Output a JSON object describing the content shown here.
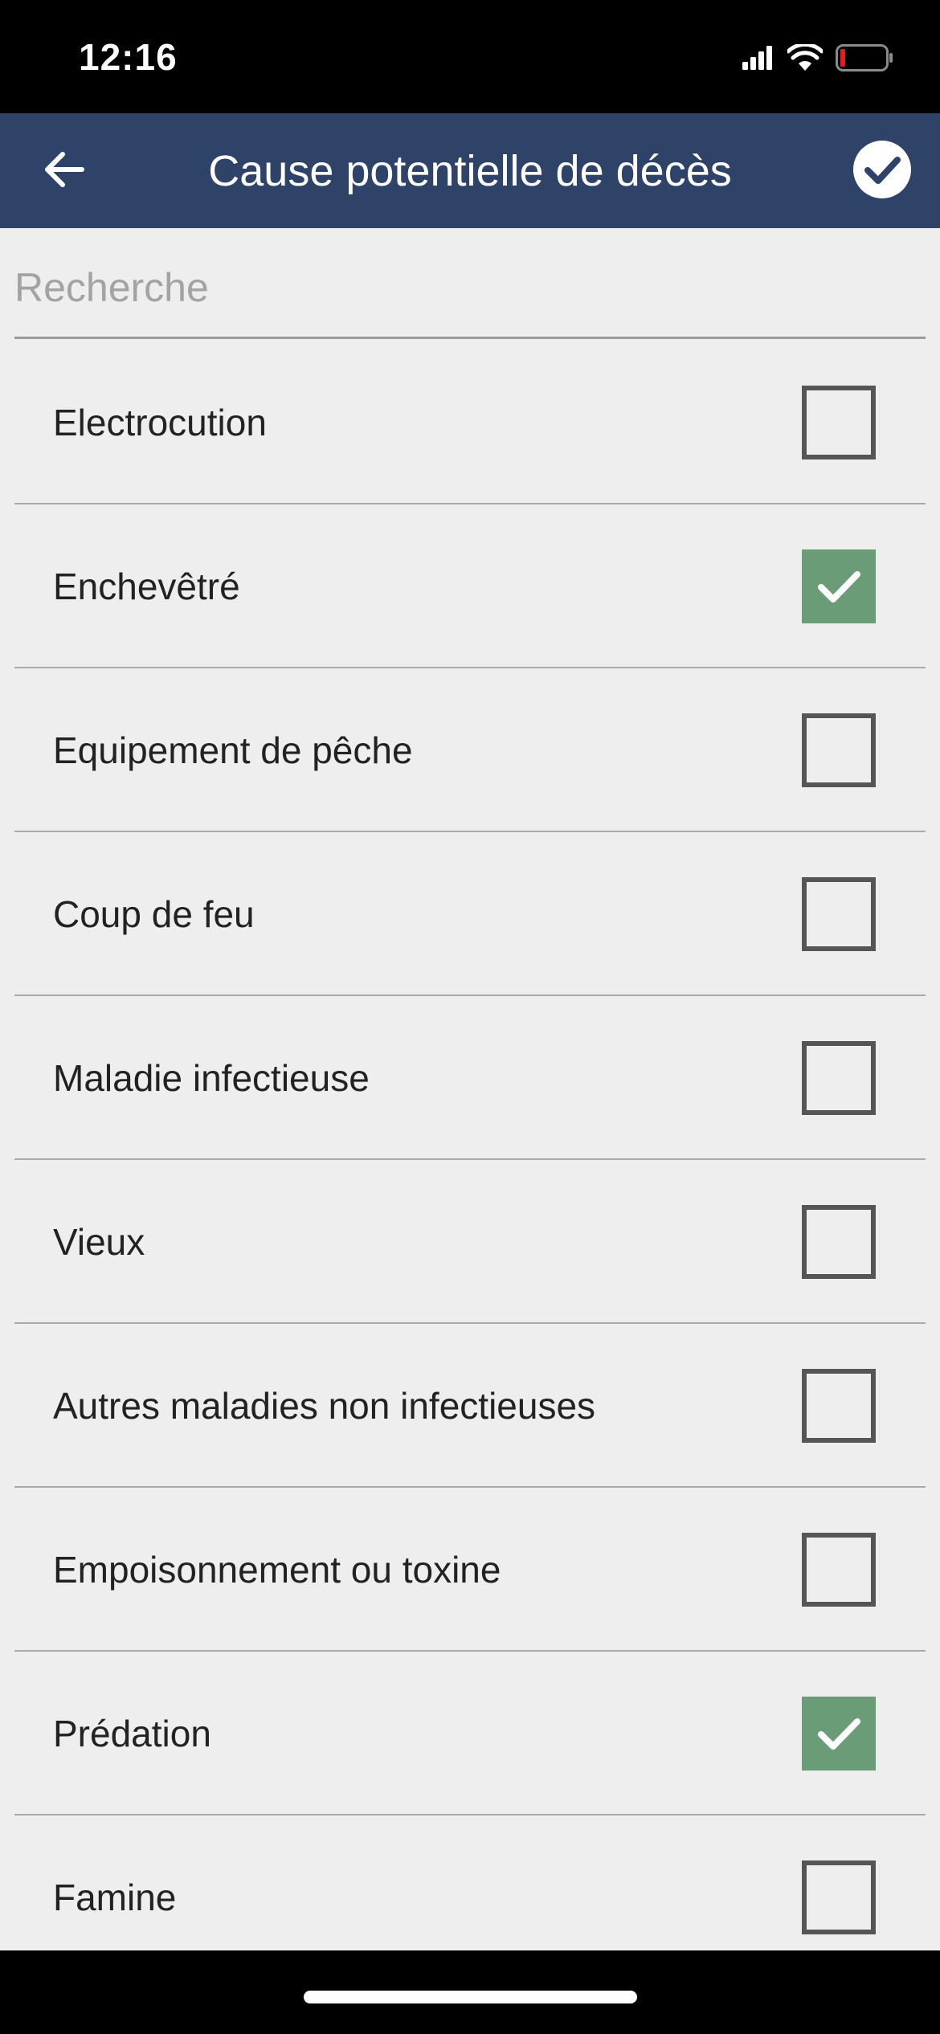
{
  "status_bar": {
    "time": "12:16",
    "icons": [
      "cellular-signal-icon",
      "wifi-icon",
      "battery-icon"
    ],
    "battery_color": "#e02020"
  },
  "header": {
    "title": "Cause potentielle de décès",
    "back_icon": "arrow-left-icon",
    "confirm_icon": "check-circle-icon",
    "background": "#2f4267"
  },
  "search": {
    "placeholder": "Recherche",
    "value": ""
  },
  "list": {
    "checked_color": "#6a9c78",
    "items": [
      {
        "label": "Electrocution",
        "checked": false
      },
      {
        "label": "Enchevêtré",
        "checked": true
      },
      {
        "label": "Equipement de pêche",
        "checked": false
      },
      {
        "label": "Coup de feu",
        "checked": false
      },
      {
        "label": "Maladie infectieuse",
        "checked": false
      },
      {
        "label": "Vieux",
        "checked": false
      },
      {
        "label": "Autres maladies non infectieuses",
        "checked": false
      },
      {
        "label": "Empoisonnement ou toxine",
        "checked": false
      },
      {
        "label": "Prédation",
        "checked": true
      },
      {
        "label": "Famine",
        "checked": false
      }
    ]
  }
}
